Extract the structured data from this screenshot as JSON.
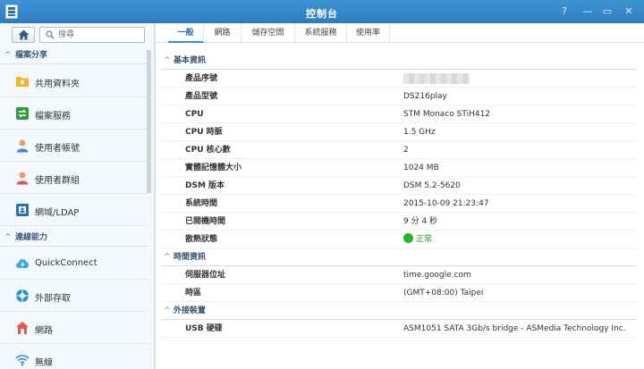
{
  "window": {
    "title": "控制台",
    "controls": [
      "?",
      "—",
      "▭",
      "✕"
    ]
  },
  "sidebar": {
    "search_placeholder": "搜尋",
    "sections": [
      {
        "label": "檔案分享"
      },
      {
        "label": "連線能力"
      }
    ],
    "items": [
      {
        "label": "共用資料夾",
        "icon": "shared-folder-icon"
      },
      {
        "label": "檔案服務",
        "icon": "file-services-icon"
      },
      {
        "label": "使用者帳號",
        "icon": "user-icon"
      },
      {
        "label": "使用者群組",
        "icon": "group-icon"
      },
      {
        "label": "網域/LDAP",
        "icon": "domain-ldap-icon"
      },
      {
        "label": "QuickConnect",
        "icon": "quickconnect-icon"
      },
      {
        "label": "外部存取",
        "icon": "external-access-icon"
      },
      {
        "label": "網路",
        "icon": "network-icon"
      },
      {
        "label": "無線",
        "icon": "wireless-icon"
      }
    ]
  },
  "tabs": [
    "一般",
    "網路",
    "儲存空間",
    "系統服務",
    "使用率"
  ],
  "active_tab": "一般",
  "groups": {
    "basic": "基本資訊",
    "time": "時間資訊",
    "external": "外接裝置"
  },
  "basic_info": [
    {
      "key": "產品序號",
      "value": ""
    },
    {
      "key": "產品型號",
      "value": "DS216play"
    },
    {
      "key": "CPU",
      "value": "STM Monaco STiH412"
    },
    {
      "key": "CPU 時脈",
      "value": "1.5 GHz"
    },
    {
      "key": "CPU 核心數",
      "value": "2"
    },
    {
      "key": "實體記憶體大小",
      "value": "1024 MB"
    },
    {
      "key": "DSM 版本",
      "value": "DSM 5.2-5620"
    },
    {
      "key": "系統時間",
      "value": "2015-10-09 21:23:47"
    },
    {
      "key": "已開機時間",
      "value": "9 分 4 秒"
    },
    {
      "key": "散熱狀態",
      "value": "正常"
    }
  ],
  "time_info": [
    {
      "key": "伺服器位址",
      "value": "time.google.com"
    },
    {
      "key": "時區",
      "value": "(GMT+08:00) Taipei"
    }
  ],
  "external_devices": [
    {
      "key": "USB 硬碟",
      "value": "ASM1051 SATA 3Gb/s bridge - ASMedia Technology Inc."
    }
  ],
  "colors": {
    "titlebar": "#2f83c7",
    "status_ok": "#27b427",
    "accent": "#3b8ed6"
  }
}
